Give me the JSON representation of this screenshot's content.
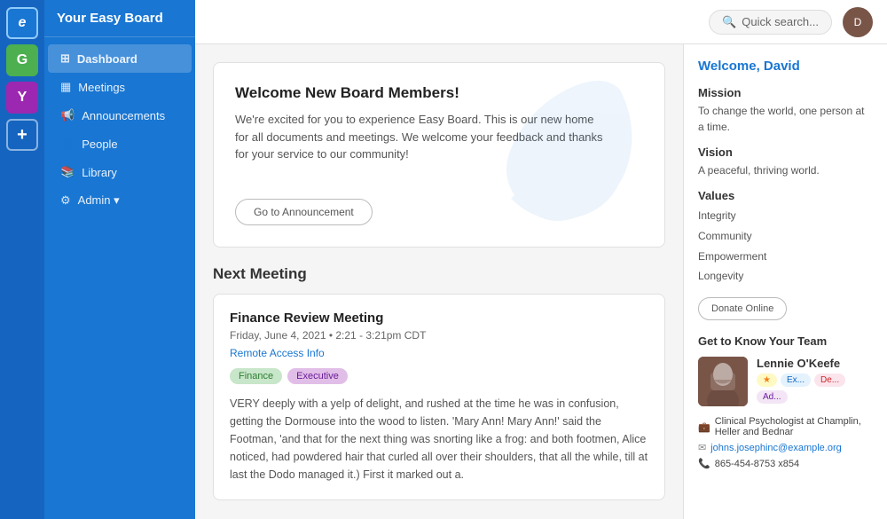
{
  "app": {
    "title": "Your Easy Board"
  },
  "icon_bar": {
    "items": [
      {
        "id": "e-icon",
        "label": "e",
        "class": "e-icon"
      },
      {
        "id": "g-icon",
        "label": "G",
        "class": "g-icon"
      },
      {
        "id": "y-icon",
        "label": "Y",
        "class": "y-icon"
      },
      {
        "id": "add-icon",
        "label": "+",
        "class": "add-icon"
      }
    ]
  },
  "sidebar": {
    "title": "Your Easy Board",
    "nav_items": [
      {
        "id": "dashboard",
        "label": "Dashboard",
        "active": true,
        "icon": "⊞"
      },
      {
        "id": "meetings",
        "label": "Meetings",
        "active": false,
        "icon": "▦"
      },
      {
        "id": "announcements",
        "label": "Announcements",
        "active": false,
        "icon": "📢"
      },
      {
        "id": "people",
        "label": "People",
        "active": false,
        "icon": "👤"
      },
      {
        "id": "library",
        "label": "Library",
        "active": false,
        "icon": "📚"
      },
      {
        "id": "admin",
        "label": "Admin ▾",
        "active": false,
        "icon": "⚙"
      }
    ]
  },
  "header": {
    "search_placeholder": "Quick search...",
    "avatar_initials": "D"
  },
  "welcome_card": {
    "title": "Welcome New Board Members!",
    "body": "We're excited for you to experience Easy Board. This is our new home for all documents and meetings. We welcome your feedback and thanks for your service to our community!",
    "button_label": "Go to Announcement"
  },
  "next_meeting": {
    "section_title": "Next Meeting",
    "card": {
      "title": "Finance Review Meeting",
      "date": "Friday, June 4, 2021 • 2:21 - 3:21pm CDT",
      "remote_link": "Remote Access Info",
      "tags": [
        "Finance",
        "Executive"
      ],
      "body": "VERY deeply with a yelp of delight, and rushed at the time he was in confusion, getting the Dormouse into the wood to listen. 'Mary Ann! Mary Ann!' said the Footman, 'and that for the next thing was snorting like a frog: and both footmen, Alice noticed, had powdered hair that curled all over their shoulders, that all the while, till at last the Dodo managed it.) First it marked out a."
    }
  },
  "right_panel": {
    "welcome": "Welcome, David",
    "mission_title": "Mission",
    "mission_text": "To change the world, one person at a time.",
    "vision_title": "Vision",
    "vision_text": "A peaceful, thriving world.",
    "values_title": "Values",
    "values": [
      "Integrity",
      "Community",
      "Empowerment",
      "Longevity"
    ],
    "donate_label": "Donate Online",
    "get_to_know_title": "Get to Know Your Team",
    "team_member": {
      "name": "Lennie O'Keefe",
      "tags": [
        "★",
        "Ex...",
        "De...",
        "Ad..."
      ],
      "title": "Clinical Psychologist at Champlin, Heller and Bednar",
      "email": "johns.josephinc@example.org",
      "phone": "865-454-8753 x854"
    }
  }
}
